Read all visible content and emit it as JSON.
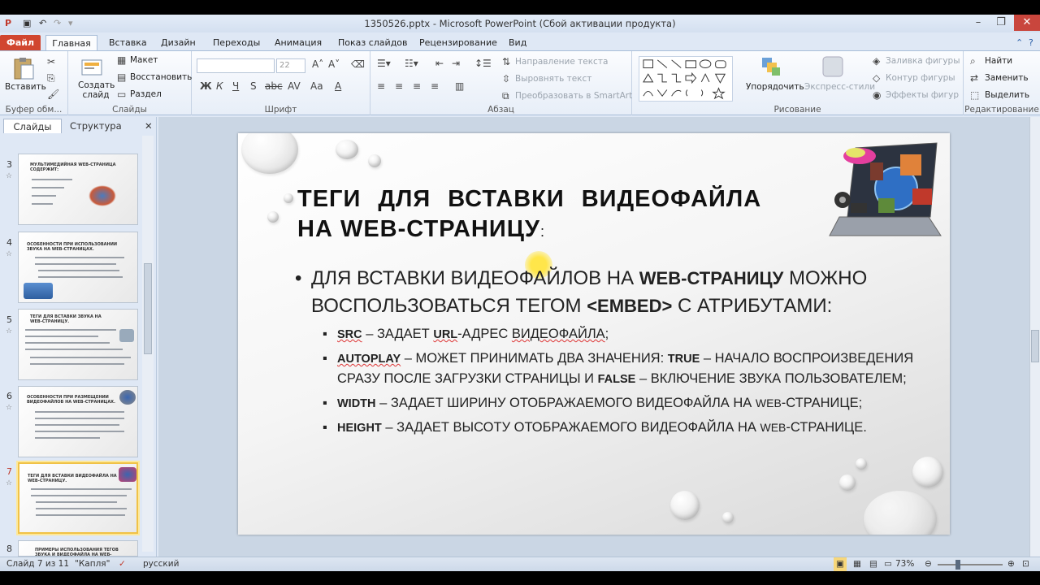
{
  "window": {
    "title": "1350526.pptx - Microsoft PowerPoint (Сбой активации продукта)"
  },
  "tabs": [
    "Файл",
    "Главная",
    "Вставка",
    "Дизайн",
    "Переходы",
    "Анимация",
    "Показ слайдов",
    "Рецензирование",
    "Вид"
  ],
  "ribbon": {
    "clipboard": {
      "paste": "Вставить",
      "label": "Буфер обм..."
    },
    "slides": {
      "new_slide": "Создать слайд",
      "layout": "Макет",
      "reset": "Восстановить",
      "section": "Раздел",
      "label": "Слайды"
    },
    "font": {
      "size": "22",
      "label": "Шрифт",
      "buttons": [
        "Ж",
        "К",
        "Ч",
        "S",
        "abc",
        "AV",
        "Aa",
        "A"
      ]
    },
    "paragraph": {
      "text_direction": "Направление текста",
      "align_text": "Выровнять текст",
      "smartart": "Преобразовать в SmartArt",
      "label": "Абзац"
    },
    "drawing": {
      "arrange": "Упорядочить",
      "quick_styles": "Экспресс-стили",
      "fill": "Заливка фигуры",
      "outline": "Контур фигуры",
      "effects": "Эффекты фигур",
      "label": "Рисование"
    },
    "editing": {
      "find": "Найти",
      "replace": "Заменить",
      "select": "Выделить",
      "label": "Редактирование"
    }
  },
  "panel": {
    "tab_slides": "Слайды",
    "tab_outline": "Структура"
  },
  "thumbnails": [
    {
      "num": "3",
      "title": "МУЛЬТИМЕДИЙНАЯ WEB-СТРАНИЦА СОДЕРЖИТ:"
    },
    {
      "num": "4",
      "title": "ОСОБЕННОСТИ ПРИ ИСПОЛЬЗОВАНИИ ЗВУКА НА WEB-СТРАНИЦАХ."
    },
    {
      "num": "5",
      "title": "ТЕГИ ДЛЯ ВСТАВКИ ЗВУКА НА WEB-СТРАНИЦУ."
    },
    {
      "num": "6",
      "title": "ОСОБЕННОСТИ ПРИ РАЗМЕЩЕНИИ ВИДЕОФАЙЛОВ НА WEB-СТРАНИЦАХ."
    },
    {
      "num": "7",
      "title": "ТЕГИ ДЛЯ ВСТАВКИ ВИДЕОФАЙЛА НА WEB-СТРАНИЦУ."
    },
    {
      "num": "8",
      "title": "ПРИМЕРЫ ИСПОЛЬЗОВАНИЯ ТЕГОВ ЗВУКА И ВИДЕОФАЙЛА НА WEB-СТРАНИЦЕ."
    }
  ],
  "slide": {
    "title_line1": "ТЕГИ ДЛЯ ВСТАВКИ ВИДЕОФАЙЛА",
    "title_line2": "НА WEB-СТРАНИЦУ",
    "title_colon": ":",
    "bullet_a": "ДЛЯ ВСТАВКИ ВИДЕОФАЙЛОВ НА ",
    "bullet_b": "WEB-СТРАНИЦУ",
    "bullet_c": " МОЖНО ВОСПОЛЬЗОВАТЬСЯ ТЕГОМ ",
    "bullet_d": "<EMBED>",
    "bullet_e": " С АТРИБУТАМИ:",
    "src_kw": "SRC",
    "src_a": " – ЗАДАЕТ ",
    "src_url": "URL",
    "src_b": "-АДРЕС ",
    "src_c": "ВИДЕОФАЙЛА",
    "src_d": ";",
    "auto_kw": "AUTOPLAY",
    "auto_a": " – МОЖЕТ ПРИНИМАТЬ ДВА ЗНАЧЕНИЯ: ",
    "auto_true": "TRUE",
    "auto_b": " – НАЧАЛО ВОСПРОИЗВЕДЕНИЯ СРАЗУ ПОСЛЕ ЗАГРУЗКИ СТРАНИЦЫ И ",
    "auto_false": "FALSE",
    "auto_c": " – ВКЛЮЧЕНИЕ ЗВУКА ПОЛЬЗОВАТЕЛЕМ;",
    "width_kw": "WIDTH",
    "width_a": " – ЗАДАЕТ ШИРИНУ ОТОБРАЖАЕМОГО ВИДЕОФАЙЛА НА ",
    "width_b": "WEB",
    "width_c": "-СТРАНИЦЕ;",
    "height_kw": "HEIGHT",
    "height_a": " – ЗАДАЕТ ВЫСОТУ ОТОБРАЖАЕМОГО ВИДЕОФАЙЛА НА ",
    "height_b": "WEB",
    "height_c": "-СТРАНИЦЕ."
  },
  "status": {
    "slide": "Слайд 7 из 11",
    "theme": "\"Капля\"",
    "lang": "русский",
    "zoom": "73%"
  }
}
